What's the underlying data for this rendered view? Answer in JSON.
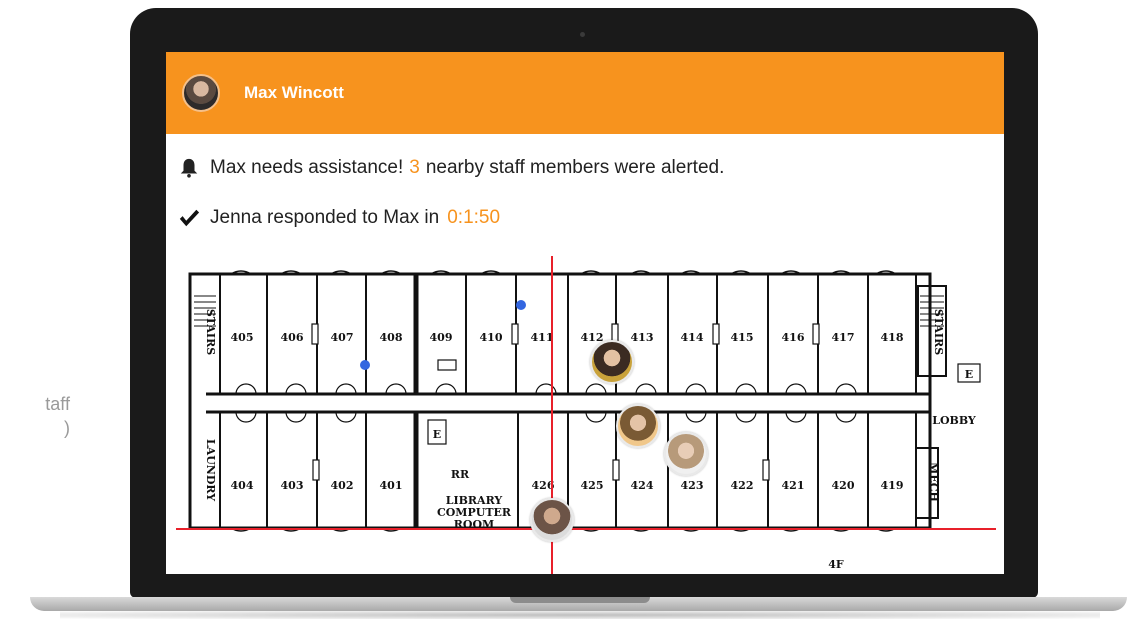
{
  "side_caption": {
    "line1": "taff",
    "line2": ")"
  },
  "header": {
    "user_name": "Max Wincott",
    "accent_color": "#f7931e"
  },
  "alert": {
    "prefix": "Max needs assistance!",
    "count": "3",
    "suffix": "nearby staff members were alerted.",
    "icon": "bell-icon"
  },
  "response": {
    "text": "Jenna responded to Max in",
    "time": "0:1:50",
    "icon": "checkmark-icon"
  },
  "floor_plan": {
    "top_rooms": [
      "405",
      "406",
      "407",
      "408",
      "409",
      "410",
      "411",
      "412",
      "413",
      "414",
      "415",
      "416",
      "417",
      "418"
    ],
    "bottom_rooms": [
      "404",
      "403",
      "402",
      "401",
      "426",
      "425",
      "424",
      "423",
      "422",
      "421",
      "420",
      "419"
    ],
    "labels": {
      "stairs_left": "STAIRS",
      "stairs_right": "STAIRS",
      "laundry": "LAUNDRY",
      "lobby": "LOBBY",
      "library": "LIBRARY",
      "computer": "COMPUTER",
      "room": "ROOM",
      "rr": "RR",
      "elevator_left": "E",
      "elevator_right": "E",
      "mech": "MECH",
      "floor": "4F"
    },
    "grid_line_color": "#e8202a",
    "marker_color": "#3366e0"
  }
}
